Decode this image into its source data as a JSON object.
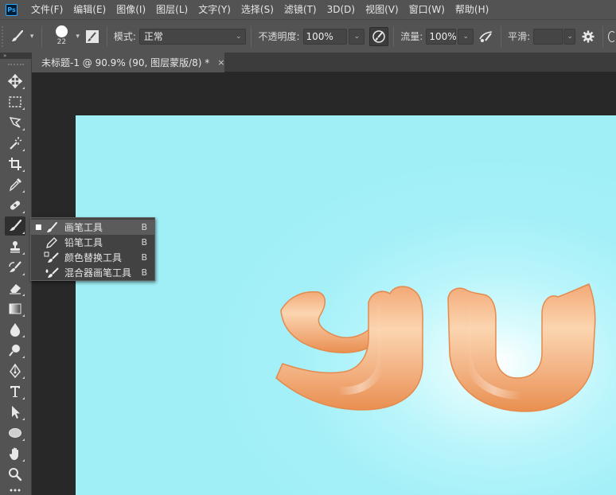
{
  "app": {
    "logo": "Ps"
  },
  "menu": [
    "文件(F)",
    "编辑(E)",
    "图像(I)",
    "图层(L)",
    "文字(Y)",
    "选择(S)",
    "滤镜(T)",
    "3D(D)",
    "视图(V)",
    "窗口(W)",
    "帮助(H)"
  ],
  "options": {
    "tool_icon": "brush-icon",
    "brush_size": "22",
    "mode_label": "模式:",
    "mode_value": "正常",
    "opacity_label": "不透明度:",
    "opacity_value": "100%",
    "flow_label": "流量:",
    "flow_value": "100%",
    "smoothing_label": "平滑:",
    "smoothing_value": ""
  },
  "toolbar": {
    "collapse_glyph": "»",
    "tools": [
      {
        "name": "move-tool",
        "icon": "move-icon"
      },
      {
        "name": "marquee-tool",
        "icon": "marquee-icon"
      },
      {
        "name": "lasso-tool",
        "icon": "lasso-icon"
      },
      {
        "name": "magic-wand-tool",
        "icon": "magic-wand-icon"
      },
      {
        "name": "crop-tool",
        "icon": "crop-icon"
      },
      {
        "name": "eyedropper-tool",
        "icon": "eyedropper-icon"
      },
      {
        "name": "healing-brush-tool",
        "icon": "bandage-icon"
      },
      {
        "name": "brush-tool",
        "icon": "brush-icon",
        "active": true
      },
      {
        "name": "clone-stamp-tool",
        "icon": "stamp-icon"
      },
      {
        "name": "history-brush-tool",
        "icon": "history-brush-icon"
      },
      {
        "name": "eraser-tool",
        "icon": "eraser-icon"
      },
      {
        "name": "gradient-tool",
        "icon": "gradient-icon"
      },
      {
        "name": "blur-tool",
        "icon": "blur-icon"
      },
      {
        "name": "dodge-tool",
        "icon": "dodge-icon"
      },
      {
        "name": "pen-tool",
        "icon": "pen-icon"
      },
      {
        "name": "type-tool",
        "icon": "type-icon"
      },
      {
        "name": "path-selection-tool",
        "icon": "arrow-icon"
      },
      {
        "name": "ellipse-tool",
        "icon": "ellipse-icon"
      },
      {
        "name": "hand-tool",
        "icon": "hand-icon"
      },
      {
        "name": "zoom-tool",
        "icon": "zoom-icon"
      },
      {
        "name": "more-tools",
        "icon": "ellipsis-icon"
      }
    ]
  },
  "document_tab": {
    "title": "未标题-1 @ 90.9% (90, 图层蒙版/8) *",
    "close": "×"
  },
  "flyout": {
    "items": [
      {
        "label": "画笔工具",
        "key": "B",
        "icon": "brush-icon",
        "selected": true
      },
      {
        "label": "铅笔工具",
        "key": "B",
        "icon": "pencil-icon",
        "selected": false
      },
      {
        "label": "颜色替换工具",
        "key": "B",
        "icon": "color-replacement-icon",
        "selected": false
      },
      {
        "label": "混合器画笔工具",
        "key": "B",
        "icon": "mixer-brush-icon",
        "selected": false
      }
    ]
  },
  "canvas": {
    "background_colors": [
      "#ffffff",
      "#a0eff7"
    ],
    "artwork_colors": [
      "#fbd5b0",
      "#e98f50"
    ],
    "artwork_text": "yu"
  }
}
